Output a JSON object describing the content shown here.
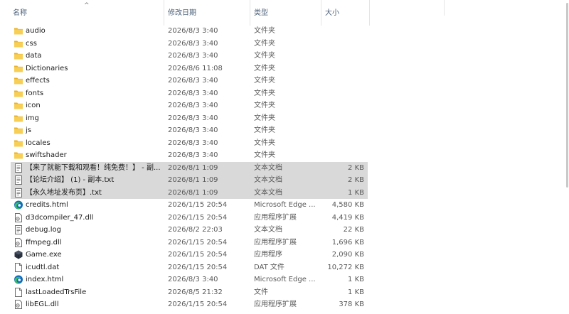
{
  "header": {
    "name": "名称",
    "modified": "修改日期",
    "type": "类型",
    "size": "大小",
    "sort_arrow": "^"
  },
  "files": [
    {
      "name": "audio",
      "date": "2026/8/3 3:40",
      "type": "文件夹",
      "size": "",
      "icon": "folder-icon",
      "selected": false
    },
    {
      "name": "css",
      "date": "2026/8/3 3:40",
      "type": "文件夹",
      "size": "",
      "icon": "folder-icon",
      "selected": false
    },
    {
      "name": "data",
      "date": "2026/8/3 3:40",
      "type": "文件夹",
      "size": "",
      "icon": "folder-icon",
      "selected": false
    },
    {
      "name": "Dictionaries",
      "date": "2026/8/6 11:08",
      "type": "文件夹",
      "size": "",
      "icon": "folder-icon",
      "selected": false
    },
    {
      "name": "effects",
      "date": "2026/8/3 3:40",
      "type": "文件夹",
      "size": "",
      "icon": "folder-icon",
      "selected": false
    },
    {
      "name": "fonts",
      "date": "2026/8/3 3:40",
      "type": "文件夹",
      "size": "",
      "icon": "folder-icon",
      "selected": false
    },
    {
      "name": "icon",
      "date": "2026/8/3 3:40",
      "type": "文件夹",
      "size": "",
      "icon": "folder-icon",
      "selected": false
    },
    {
      "name": "img",
      "date": "2026/8/3 3:40",
      "type": "文件夹",
      "size": "",
      "icon": "folder-icon",
      "selected": false
    },
    {
      "name": "js",
      "date": "2026/8/3 3:40",
      "type": "文件夹",
      "size": "",
      "icon": "folder-icon",
      "selected": false
    },
    {
      "name": "locales",
      "date": "2026/8/3 3:40",
      "type": "文件夹",
      "size": "",
      "icon": "folder-icon",
      "selected": false
    },
    {
      "name": "swiftshader",
      "date": "2026/8/3 3:40",
      "type": "文件夹",
      "size": "",
      "icon": "folder-icon",
      "selected": false
    },
    {
      "name": "【来了就能下载和观看！纯免费！】 - 副...",
      "date": "2026/8/1 1:09",
      "type": "文本文档",
      "size": "2 KB",
      "icon": "text-file-icon",
      "selected": true
    },
    {
      "name": "【论坛介绍】 (1) - 副本.txt",
      "date": "2026/8/1 1:09",
      "type": "文本文档",
      "size": "2 KB",
      "icon": "text-file-icon",
      "selected": true
    },
    {
      "name": "【永久地址发布页】.txt",
      "date": "2026/8/1 1:09",
      "type": "文本文档",
      "size": "1 KB",
      "icon": "text-file-icon",
      "selected": true
    },
    {
      "name": "credits.html",
      "date": "2026/1/15 20:54",
      "type": "Microsoft Edge ...",
      "size": "4,580 KB",
      "icon": "edge-icon",
      "selected": false
    },
    {
      "name": "d3dcompiler_47.dll",
      "date": "2026/1/15 20:54",
      "type": "应用程序扩展",
      "size": "4,419 KB",
      "icon": "dll-file-icon",
      "selected": false
    },
    {
      "name": "debug.log",
      "date": "2026/8/2 22:03",
      "type": "文本文档",
      "size": "22 KB",
      "icon": "text-file-icon",
      "selected": false
    },
    {
      "name": "ffmpeg.dll",
      "date": "2026/1/15 20:54",
      "type": "应用程序扩展",
      "size": "1,696 KB",
      "icon": "dll-file-icon",
      "selected": false
    },
    {
      "name": "Game.exe",
      "date": "2026/1/15 20:54",
      "type": "应用程序",
      "size": "2,090 KB",
      "icon": "game-exe-icon",
      "selected": false
    },
    {
      "name": "icudtl.dat",
      "date": "2026/1/15 20:54",
      "type": "DAT 文件",
      "size": "10,272 KB",
      "icon": "blank-file-icon",
      "selected": false
    },
    {
      "name": "index.html",
      "date": "2026/8/3 3:40",
      "type": "Microsoft Edge ...",
      "size": "1 KB",
      "icon": "edge-icon",
      "selected": false
    },
    {
      "name": "lastLoadedTrsFile",
      "date": "2026/8/5 21:32",
      "type": "文件",
      "size": "1 KB",
      "icon": "blank-file-icon",
      "selected": false
    },
    {
      "name": "libEGL.dll",
      "date": "2026/1/15 20:54",
      "type": "应用程序扩展",
      "size": "378 KB",
      "icon": "dll-file-icon",
      "selected": false
    }
  ],
  "colors": {
    "folder": "#f5c645",
    "selection": "#d9d9d9",
    "header_text": "#4c607a",
    "edge_blue": "#0f6cbd",
    "edge_green": "#3cc05c"
  }
}
